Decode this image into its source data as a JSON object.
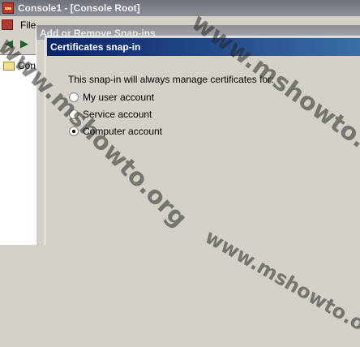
{
  "window": {
    "title": "Console1 - [Console Root]"
  },
  "menubar": {
    "file": "File"
  },
  "tree": {
    "root_label": "Console Root"
  },
  "back_dialog": {
    "title": "Add or Remove Snap-ins"
  },
  "cert_dialog": {
    "title": "Certificates snap-in",
    "instruction": "This snap-in will always manage certificates for:",
    "options": [
      {
        "label": "My user account",
        "checked": false
      },
      {
        "label": "Service account",
        "checked": false
      },
      {
        "label": "Computer account",
        "checked": true
      }
    ]
  },
  "watermark": {
    "text": "www.mshowto.org"
  },
  "colors": {
    "title_active": "#0a246a",
    "title_inactive": "#8b8f98",
    "face": "#d4d0c8"
  }
}
